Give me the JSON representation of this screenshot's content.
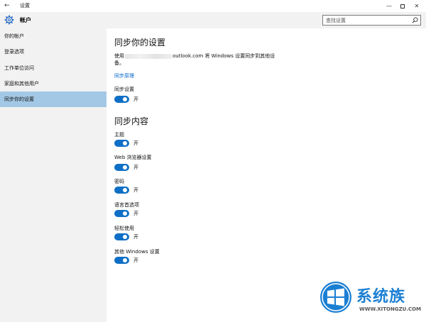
{
  "window": {
    "title": "设置",
    "back_glyph": "←",
    "min_glyph": "—",
    "close_glyph": "✕"
  },
  "header": {
    "title": "帐户",
    "search_placeholder": "查找设置"
  },
  "sidebar": {
    "items": [
      {
        "label": "你的帐户"
      },
      {
        "label": "登录选项"
      },
      {
        "label": "工作单位访问"
      },
      {
        "label": "家庭和其他用户"
      },
      {
        "label": "同步你的设置",
        "selected": true
      }
    ]
  },
  "main": {
    "title": "同步你的设置",
    "description_prefix": "使用",
    "description_suffix": "outlook.com 将 Windows 设置同步到其他设备。",
    "how_link": "同步原理",
    "sync_setting": {
      "label": "同步设置",
      "state": "开",
      "on": true
    },
    "content_title": "同步内容",
    "toggles": [
      {
        "label": "主题",
        "state": "开",
        "on": true
      },
      {
        "label": "Web 浏览器设置",
        "state": "开",
        "on": true
      },
      {
        "label": "密码",
        "state": "开",
        "on": true
      },
      {
        "label": "语言首选项",
        "state": "开",
        "on": true
      },
      {
        "label": "轻松使用",
        "state": "开",
        "on": true
      },
      {
        "label": "其他 Windows 设置",
        "state": "开",
        "on": true
      }
    ]
  },
  "watermark": {
    "brand": "系统族",
    "url": "WWW.XITONGZU.COM"
  },
  "colors": {
    "accent": "#0f6fc6",
    "selected_nav": "#a3c8e6",
    "link": "#0066cc"
  }
}
